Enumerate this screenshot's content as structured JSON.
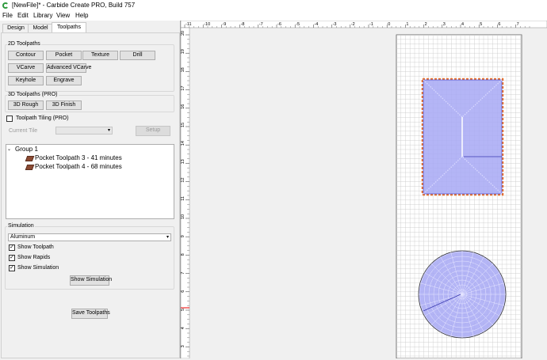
{
  "window": {
    "title": "[NewFile]* - Carbide Create PRO, Build 757"
  },
  "menu": [
    "File",
    "Edit",
    "Library",
    "View",
    "Help"
  ],
  "tabs": [
    "Design",
    "Model",
    "Toolpaths"
  ],
  "active_tab": "Toolpaths",
  "toolpaths_2d": {
    "title": "2D Toolpaths",
    "buttons": [
      "Contour",
      "Pocket",
      "Texture",
      "Drill",
      "VCarve",
      "Advanced VCarve",
      "Keyhole",
      "Engrave"
    ]
  },
  "toolpaths_3d": {
    "title": "3D Toolpaths (PRO)",
    "buttons": [
      "3D Rough",
      "3D Finish"
    ]
  },
  "tiling": {
    "label": "Toolpath Tiling (PRO)",
    "checked": false,
    "current_tile_label": "Current Tile",
    "setup_label": "Setup"
  },
  "tree": {
    "group_label": "Group 1",
    "expand_glyph": "⌄",
    "items": [
      "Pocket Toolpath 3 - 41 minutes",
      "Pocket Toolpath 4 - 68 minutes"
    ]
  },
  "simulation": {
    "title": "Simulation",
    "material": "Aluminum",
    "checkboxes": [
      {
        "label": "Show Toolpath",
        "checked": true
      },
      {
        "label": "Show Rapids",
        "checked": true
      },
      {
        "label": "Show Simulation",
        "checked": true
      }
    ],
    "show_button": "Show Simulation"
  },
  "save_button": "Save Toolpaths",
  "ruler": {
    "x_labels": [
      "-11",
      "-10",
      "-9",
      "-8",
      "-7",
      "-6",
      "-5",
      "-4",
      "-3",
      "-2",
      "-1",
      "0",
      "1",
      "2",
      "3",
      "4",
      "5",
      "6",
      "7"
    ],
    "y_labels": [
      "20",
      "19",
      "18",
      "17",
      "16",
      "15",
      "14",
      "13",
      "12",
      "11",
      "10",
      "9",
      "8",
      "7",
      "6",
      "5",
      "4",
      "3"
    ]
  },
  "colors": {
    "toolpath_fill": "#a7a8f5",
    "toolpath_stroke": "#5a5ad6",
    "selection_orange": "#e8702a",
    "stock_bg": "#ffffff",
    "grid": "#c8c8c8"
  }
}
